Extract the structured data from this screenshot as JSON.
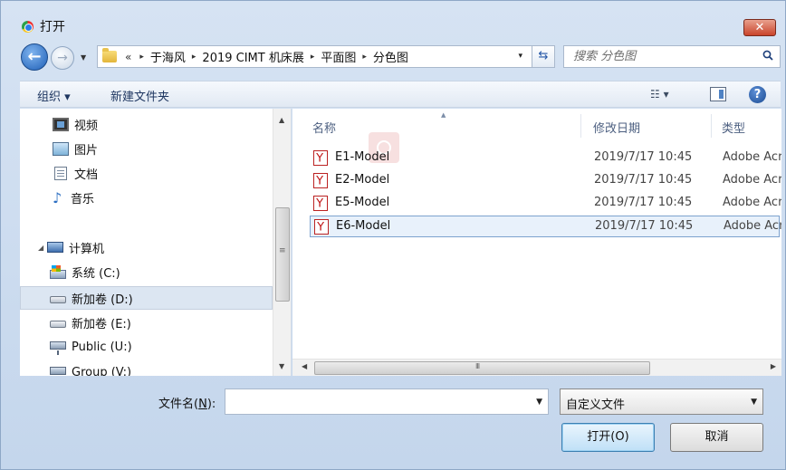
{
  "window": {
    "title": "打开",
    "close_label": "✕"
  },
  "address": {
    "prefix": "«",
    "crumbs": [
      "于海风",
      "2019 CIMT 机床展",
      "平面图",
      "分色图"
    ],
    "separator": "▸",
    "dropdown": "▾",
    "refresh": "⇆"
  },
  "search": {
    "placeholder": "搜索 分色图"
  },
  "toolbar": {
    "organize": "组织 ▾",
    "new_folder": "新建文件夹",
    "view": "☷ ▾",
    "help": "?"
  },
  "nav": {
    "items": [
      {
        "label": "视频"
      },
      {
        "label": "图片"
      },
      {
        "label": "文档"
      },
      {
        "label": "音乐"
      },
      {
        "label": "计算机"
      },
      {
        "label": "系统 (C:)"
      },
      {
        "label": "新加卷 (D:)"
      },
      {
        "label": "新加卷 (E:)"
      },
      {
        "label": "Public (U:)"
      },
      {
        "label": "Group (V:)"
      }
    ],
    "selected": "新加卷 (D:)"
  },
  "files": {
    "columns": {
      "name": "名称",
      "date": "修改日期",
      "type": "类型"
    },
    "rows": [
      {
        "name": "E1-Model",
        "date": "2019/7/17 10:45",
        "type": "Adobe Acrobat"
      },
      {
        "name": "E2-Model",
        "date": "2019/7/17 10:45",
        "type": "Adobe Acrobat"
      },
      {
        "name": "E5-Model",
        "date": "2019/7/17 10:45",
        "type": "Adobe Acrobat"
      },
      {
        "name": "E6-Model",
        "date": "2019/7/17 10:45",
        "type": "Adobe Acrobat"
      }
    ],
    "selected": "E6-Model"
  },
  "bottom": {
    "filename_label": "文件名(",
    "filename_key": "N",
    "filename_label_end": "):",
    "filename_value": "",
    "filetype": "自定义文件",
    "open_button": "打开(O)",
    "cancel_button": "取消"
  }
}
